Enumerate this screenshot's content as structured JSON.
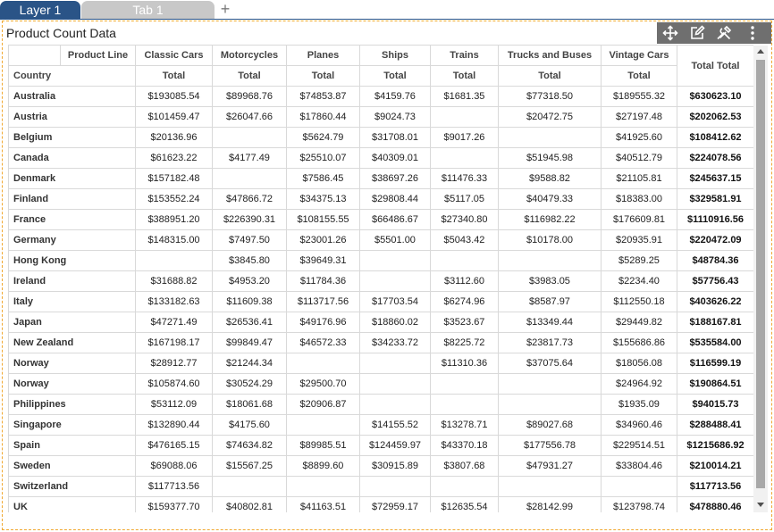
{
  "tabs": [
    {
      "label": "Layer 1"
    },
    {
      "label": "Tab 1"
    }
  ],
  "widget": {
    "title": "Product Count Data",
    "toolbar_icons": [
      "move-icon",
      "edit-icon",
      "settings-icon",
      "more-icon"
    ]
  },
  "table": {
    "corner_label": "Product Line",
    "row_header_label": "Country",
    "columns": [
      {
        "name": "Classic Cars",
        "measure": "Total"
      },
      {
        "name": "Motorcycles",
        "measure": "Total"
      },
      {
        "name": "Planes",
        "measure": "Total"
      },
      {
        "name": "Ships",
        "measure": "Total"
      },
      {
        "name": "Trains",
        "measure": "Total"
      },
      {
        "name": "Trucks and Buses",
        "measure": "Total"
      },
      {
        "name": "Vintage Cars",
        "measure": "Total"
      }
    ],
    "grand_total_label": "Total Total",
    "rows": [
      {
        "country": "Australia",
        "values": [
          "$193085.54",
          "$89968.76",
          "$74853.87",
          "$4159.76",
          "$1681.35",
          "$77318.50",
          "$189555.32"
        ],
        "total": "$630623.10"
      },
      {
        "country": "Austria",
        "values": [
          "$101459.47",
          "$26047.66",
          "$17860.44",
          "$9024.73",
          "",
          "$20472.75",
          "$27197.48"
        ],
        "total": "$202062.53"
      },
      {
        "country": "Belgium",
        "values": [
          "$20136.96",
          "",
          "$5624.79",
          "$31708.01",
          "$9017.26",
          "",
          "$41925.60"
        ],
        "total": "$108412.62"
      },
      {
        "country": "Canada",
        "values": [
          "$61623.22",
          "$4177.49",
          "$25510.07",
          "$40309.01",
          "",
          "$51945.98",
          "$40512.79"
        ],
        "total": "$224078.56"
      },
      {
        "country": "Denmark",
        "values": [
          "$157182.48",
          "",
          "$7586.45",
          "$38697.26",
          "$11476.33",
          "$9588.82",
          "$21105.81"
        ],
        "total": "$245637.15"
      },
      {
        "country": "Finland",
        "values": [
          "$153552.24",
          "$47866.72",
          "$34375.13",
          "$29808.44",
          "$5117.05",
          "$40479.33",
          "$18383.00"
        ],
        "total": "$329581.91"
      },
      {
        "country": "France",
        "values": [
          "$388951.20",
          "$226390.31",
          "$108155.55",
          "$66486.67",
          "$27340.80",
          "$116982.22",
          "$176609.81"
        ],
        "total": "$1110916.56"
      },
      {
        "country": "Germany",
        "values": [
          "$148315.00",
          "$7497.50",
          "$23001.26",
          "$5501.00",
          "$5043.42",
          "$10178.00",
          "$20935.91"
        ],
        "total": "$220472.09"
      },
      {
        "country": "Hong Kong",
        "values": [
          "",
          "$3845.80",
          "$39649.31",
          "",
          "",
          "",
          "$5289.25"
        ],
        "total": "$48784.36"
      },
      {
        "country": "Ireland",
        "values": [
          "$31688.82",
          "$4953.20",
          "$11784.36",
          "",
          "$3112.60",
          "$3983.05",
          "$2234.40"
        ],
        "total": "$57756.43"
      },
      {
        "country": "Italy",
        "values": [
          "$133182.63",
          "$11609.38",
          "$113717.56",
          "$17703.54",
          "$6274.96",
          "$8587.97",
          "$112550.18"
        ],
        "total": "$403626.22"
      },
      {
        "country": "Japan",
        "values": [
          "$47271.49",
          "$26536.41",
          "$49176.96",
          "$18860.02",
          "$3523.67",
          "$13349.44",
          "$29449.82"
        ],
        "total": "$188167.81"
      },
      {
        "country": "New Zealand",
        "values": [
          "$167198.17",
          "$99849.47",
          "$46572.33",
          "$34233.72",
          "$8225.72",
          "$23817.73",
          "$155686.86"
        ],
        "total": "$535584.00"
      },
      {
        "country": "Norway",
        "values": [
          "$28912.77",
          "$21244.34",
          "",
          "",
          "$11310.36",
          "$37075.64",
          "$18056.08"
        ],
        "total": "$116599.19"
      },
      {
        "country": "Norway",
        "values": [
          "$105874.60",
          "$30524.29",
          "$29500.70",
          "",
          "",
          "",
          "$24964.92"
        ],
        "total": "$190864.51"
      },
      {
        "country": "Philippines",
        "values": [
          "$53112.09",
          "$18061.68",
          "$20906.87",
          "",
          "",
          "",
          "$1935.09"
        ],
        "total": "$94015.73"
      },
      {
        "country": "Singapore",
        "values": [
          "$132890.44",
          "$4175.60",
          "",
          "$14155.52",
          "$13278.71",
          "$89027.68",
          "$34960.46"
        ],
        "total": "$288488.41"
      },
      {
        "country": "Spain",
        "values": [
          "$476165.15",
          "$74634.82",
          "$89985.51",
          "$124459.97",
          "$43370.18",
          "$177556.78",
          "$229514.51"
        ],
        "total": "$1215686.92"
      },
      {
        "country": "Sweden",
        "values": [
          "$69088.06",
          "$15567.25",
          "$8899.60",
          "$30915.89",
          "$3807.68",
          "$47931.27",
          "$33804.46"
        ],
        "total": "$210014.21"
      },
      {
        "country": "Switzerland",
        "values": [
          "$117713.56",
          "",
          "",
          "",
          "",
          "",
          ""
        ],
        "total": "$117713.56"
      },
      {
        "country": "UK",
        "values": [
          "$159377.70",
          "$40802.81",
          "$41163.51",
          "$72959.17",
          "$12635.54",
          "$28142.99",
          "$123798.74"
        ],
        "total": "$478880.46"
      }
    ]
  },
  "colors": {
    "active_tab": "#2a5487",
    "inactive_tab": "#c8c8c8",
    "selection_border": "#f0a830",
    "toolbar_bg": "#6f6f6f"
  }
}
